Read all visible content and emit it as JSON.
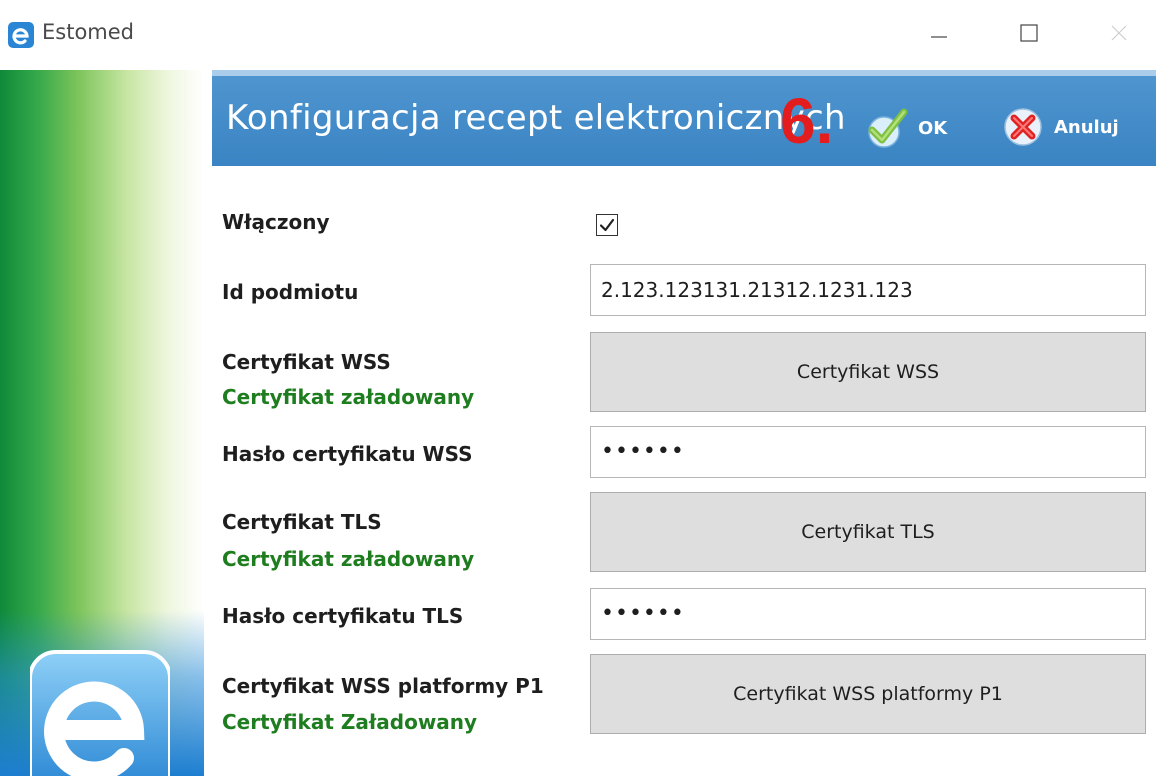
{
  "window": {
    "title": "Estomed",
    "icon": "estomed-e-icon"
  },
  "header": {
    "title": "Konfiguracja recept elektronicznych",
    "step_annotation": "6.",
    "ok_label": "OK",
    "cancel_label": "Anuluj",
    "colors": {
      "band": "#3a84c3",
      "annotation": "#e31d1d",
      "status_green": "#1e7d1e"
    }
  },
  "form": {
    "enabled": {
      "label": "Włączony",
      "checked": true
    },
    "entity_id": {
      "label": "Id podmiotu",
      "value": "2.123.123131.21312.1231.123"
    },
    "wss_cert": {
      "label": "Certyfikat WSS",
      "status": "Certyfikat załadowany",
      "button_label": "Certyfikat WSS"
    },
    "wss_password": {
      "label": "Hasło certyfikatu WSS",
      "value": "••••••"
    },
    "tls_cert": {
      "label": "Certyfikat TLS",
      "status": "Certyfikat załadowany",
      "button_label": "Certyfikat TLS"
    },
    "tls_password": {
      "label": "Hasło certyfikatu TLS",
      "value": "••••••"
    },
    "p1_cert": {
      "label": "Certyfikat WSS platformy P1",
      "status": "Certyfikat Załadowany",
      "button_label": "Certyfikat WSS platformy P1"
    }
  }
}
